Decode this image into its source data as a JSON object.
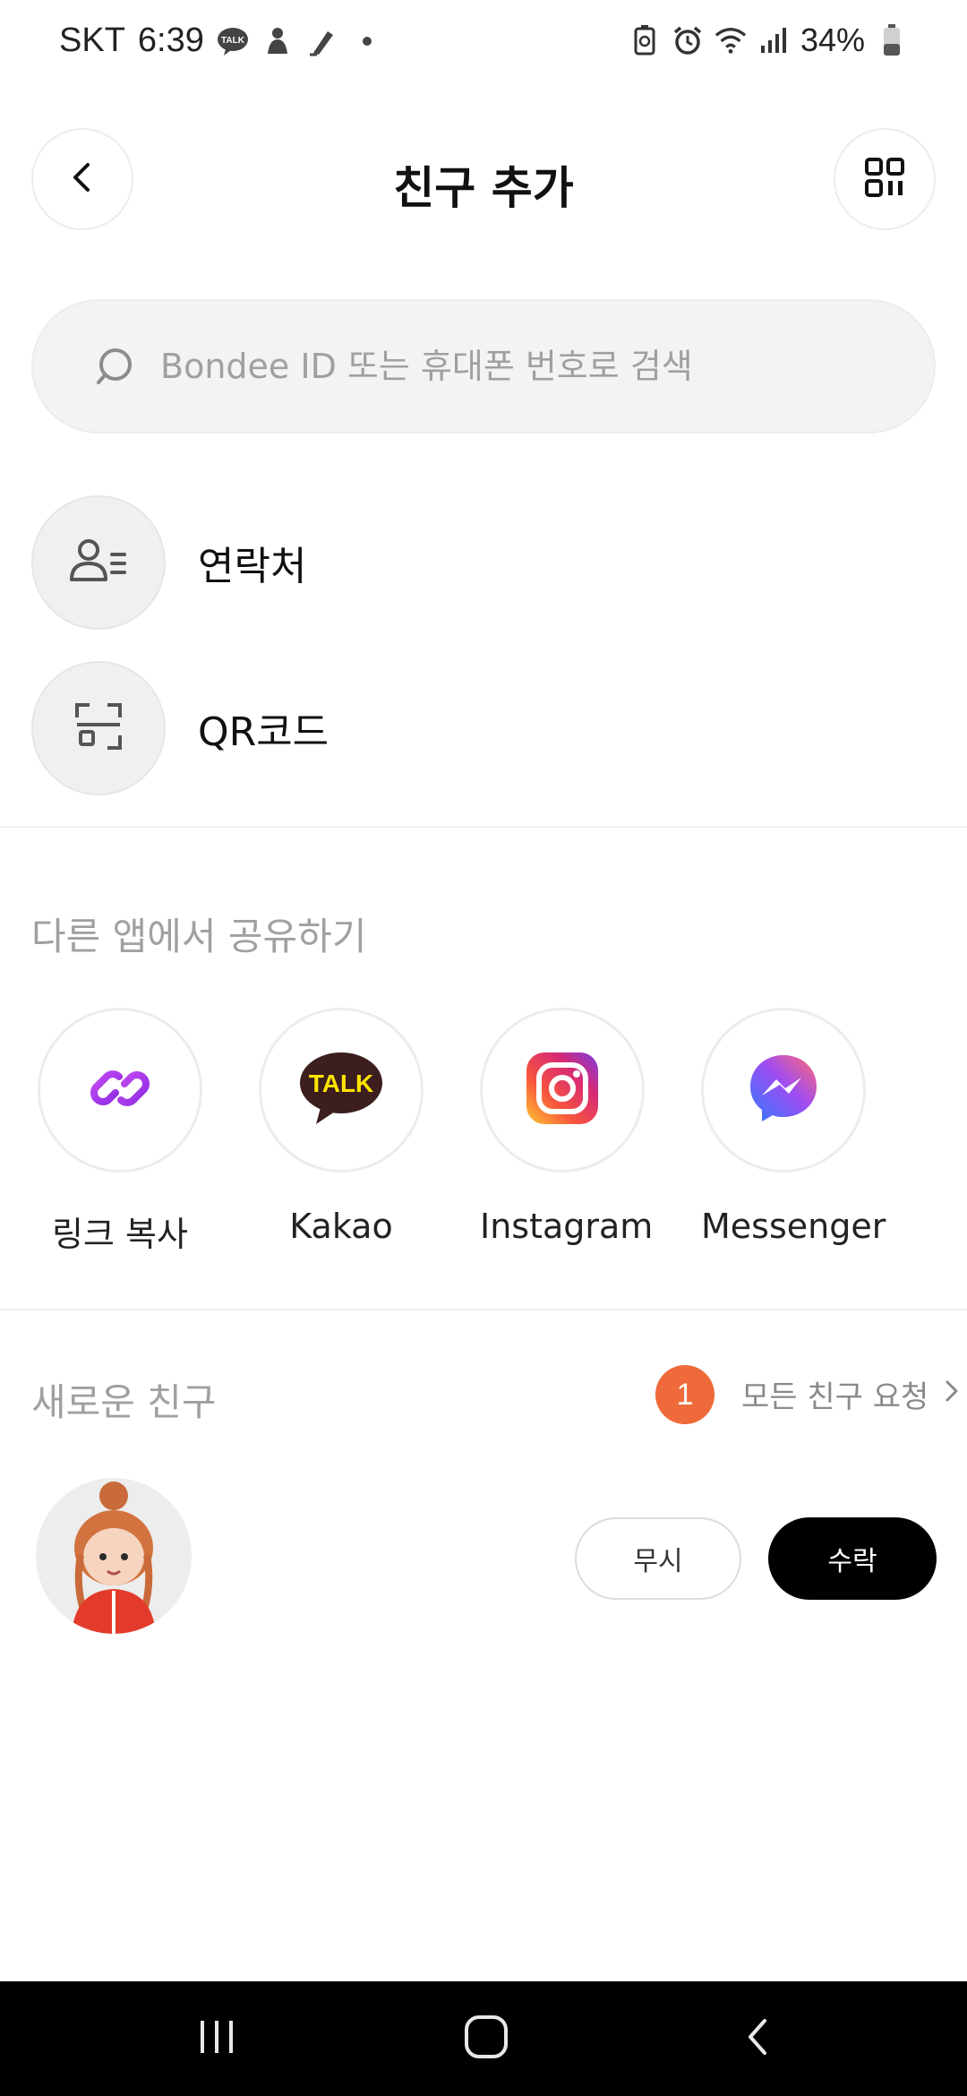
{
  "status_bar": {
    "carrier": "SKT",
    "time": "6:39",
    "talk_badge": "TALK",
    "battery_percent": "34%"
  },
  "header": {
    "title": "친구 추가"
  },
  "search": {
    "placeholder": "Bondee ID 또는 휴대폰 번호로 검색",
    "value": ""
  },
  "options": [
    {
      "label": "연락처",
      "icon": "contacts-icon"
    },
    {
      "label": "QR코드",
      "icon": "qr-scan-icon"
    }
  ],
  "share": {
    "title": "다른 앱에서 공유하기",
    "items": [
      {
        "label": "링크 복사",
        "icon": "link-icon"
      },
      {
        "label": "Kakao",
        "icon": "kakaotalk-icon",
        "badge_text": "TALK"
      },
      {
        "label": "Instagram",
        "icon": "instagram-icon"
      },
      {
        "label": "Messenger",
        "icon": "messenger-icon"
      }
    ]
  },
  "new_friends": {
    "title": "새로운 친구",
    "count": "1",
    "all_requests_label": "모든 친구 요청",
    "requests": [
      {
        "name": "",
        "ignore_label": "무시",
        "accept_label": "수락"
      }
    ]
  },
  "colors": {
    "accent": "#ef6a3b",
    "link_purple": "#a43ce8",
    "kakao_yellow": "#fee500",
    "kakao_brown": "#3c1e1e"
  }
}
